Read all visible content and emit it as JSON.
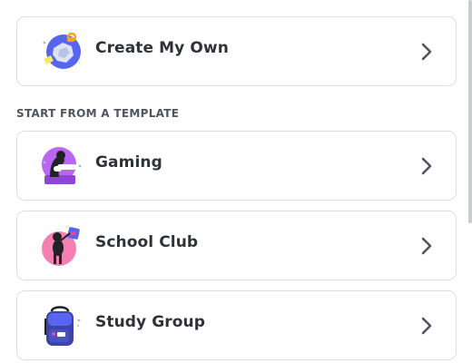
{
  "create_own": {
    "label": "Create My Own",
    "icon": "globe-create-icon"
  },
  "section_heading": "START FROM A TEMPLATE",
  "templates": [
    {
      "label": "Gaming",
      "icon": "gaming-controller-icon"
    },
    {
      "label": "School Club",
      "icon": "school-club-icon"
    },
    {
      "label": "Study Group",
      "icon": "backpack-icon"
    }
  ],
  "colors": {
    "text_primary": "#2e3338",
    "text_secondary": "#4f5660",
    "border": "#dcdee2",
    "chevron": "#4f5660"
  }
}
